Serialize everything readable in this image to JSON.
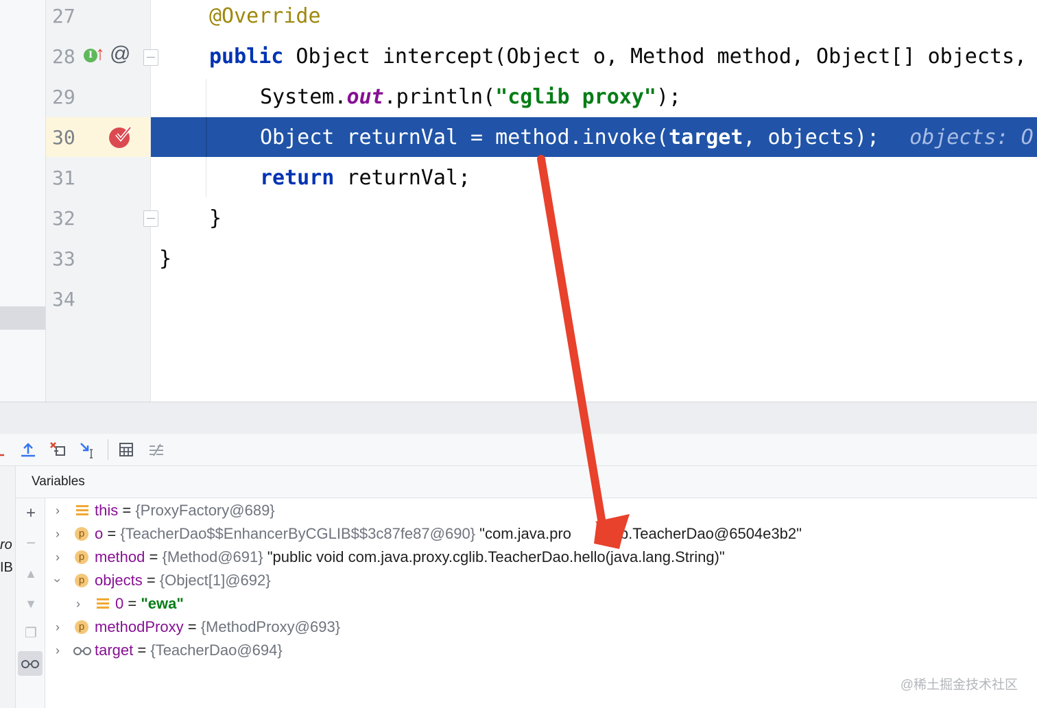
{
  "editor": {
    "line_numbers": [
      "27",
      "28",
      "29",
      "30",
      "31",
      "32",
      "33",
      "34"
    ],
    "lines": {
      "l27": {
        "annotation": "@Override"
      },
      "l28": {
        "kw": "public",
        "text": " Object intercept(Object o, Method method, Object[] objects,"
      },
      "l29": {
        "pre": "System.",
        "field": "out",
        "mid": ".println(",
        "str": "\"cglib proxy\"",
        "post": ");"
      },
      "l30": {
        "pre": "Object returnVal = method.invoke(",
        "bold": "target",
        "post": ", objects);",
        "hint": "objects: O"
      },
      "l31": {
        "kw": "return",
        "text": " returnVal;"
      },
      "l32": {
        "text": "}"
      },
      "l33": {
        "text": "}"
      }
    },
    "gutter_icons": {
      "implements_icon": "I",
      "up_arrow": "↑",
      "annotation_at": "@"
    }
  },
  "debug": {
    "variables_title": "Variables",
    "variables": [
      {
        "name": "this",
        "eq": " = ",
        "value": "{ProxyFactory@689}",
        "extra": ""
      },
      {
        "name": "o",
        "eq": " = ",
        "value": "{TeacherDao$$EnhancerByCGLIB$$3c87fe87@690}",
        "extra": " \"com.java.pro",
        "extra2": "cglib.TeacherDao@6504e3b2\""
      },
      {
        "name": "method",
        "eq": " = ",
        "value": "{Method@691}",
        "extra": " \"public void com.java.proxy.cglib.TeacherDao.hello(java.lang.String)\""
      },
      {
        "name": "objects",
        "eq": " = ",
        "value": "{Object[1]@692}",
        "extra": ""
      },
      {
        "name": "0",
        "eq": " = ",
        "value": "\"ewa\"",
        "extra": ""
      },
      {
        "name": "methodProxy",
        "eq": " = ",
        "value": "{MethodProxy@693}",
        "extra": ""
      },
      {
        "name": "target",
        "eq": " = ",
        "value": "{TeacherDao@694}",
        "extra": ""
      }
    ],
    "side_fragments": [
      "ro",
      "IB"
    ],
    "param_icon_letter": "p"
  },
  "watermark": "@稀土掘金技术社区",
  "colors": {
    "exec_line": "#2154a8",
    "keyword": "#0033b3",
    "string": "#067d17",
    "var_name": "#871094",
    "arrow": "#e8412c"
  }
}
